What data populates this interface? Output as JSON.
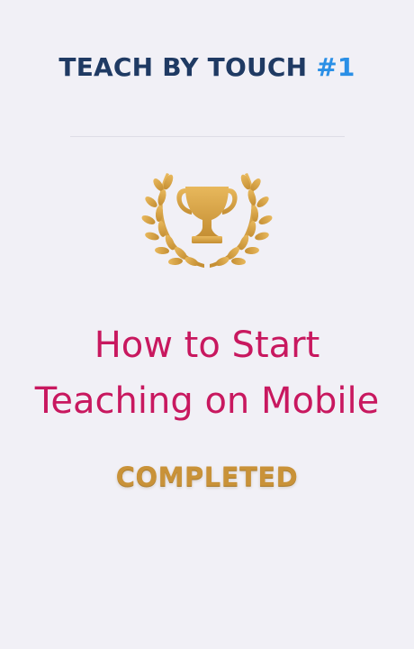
{
  "header": {
    "title_prefix": "TEACH BY TOUCH",
    "title_number": "#1"
  },
  "badge": {
    "icon": "trophy-laurel-icon",
    "color": "#d4a24c"
  },
  "lesson": {
    "title_line1": "How to Start",
    "title_line2": "Teaching on Mobile"
  },
  "status": {
    "label": "COMPLETED"
  },
  "colors": {
    "background": "#f1f0f6",
    "header": "#1f3a63",
    "accent_number": "#2a8fe6",
    "lesson_title": "#c8185f",
    "gold": "#c99238"
  }
}
